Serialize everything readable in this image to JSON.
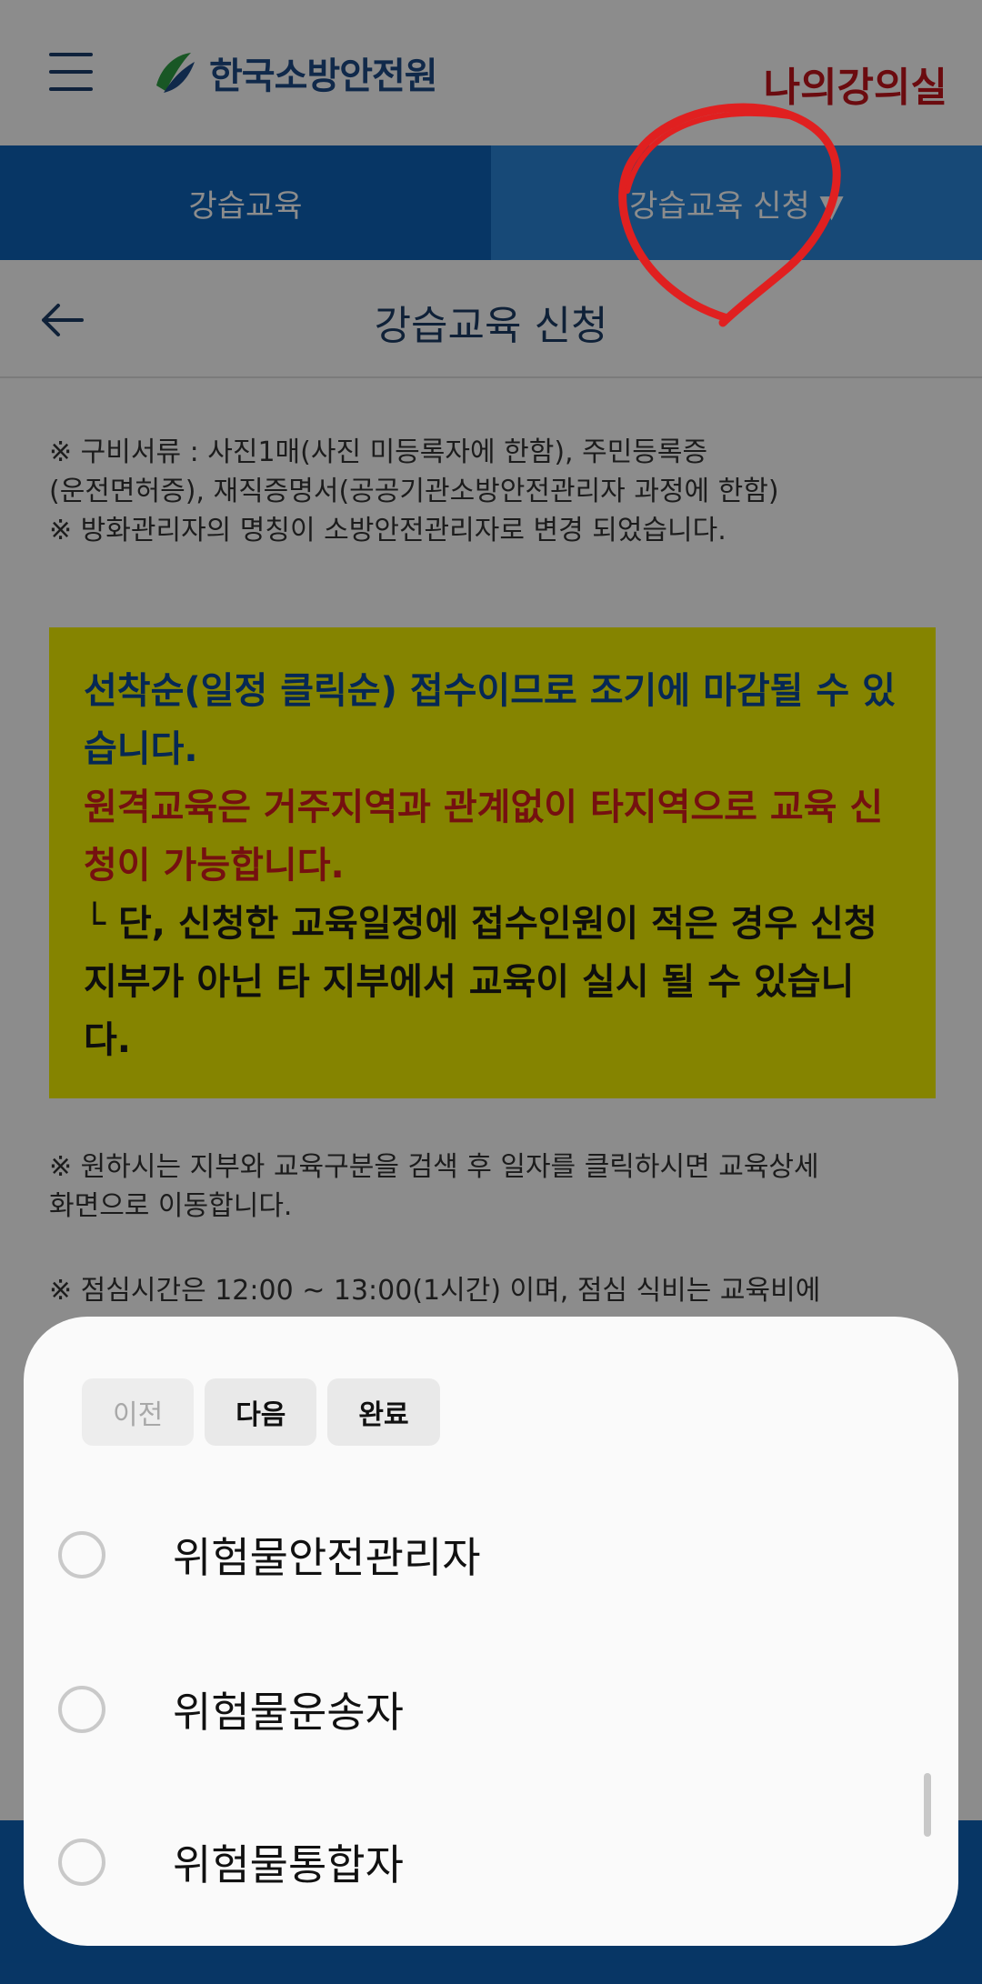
{
  "header": {
    "logo_text": "한국소방안전원",
    "my_class_label": "나의강의실"
  },
  "tabs": [
    {
      "label": "강습교육"
    },
    {
      "label": "강습교육 신청 ▼"
    }
  ],
  "page": {
    "title": "강습교육 신청"
  },
  "notices": {
    "docs_line1": "※ 구비서류 : 사진1매(사진 미등록자에 한함), 주민등록증",
    "docs_line2": "(운전면허증), 재직증명서(공공기관소방안전관리자 과정에 한함)",
    "rename_line": "※ 방화관리자의 명칭이 소방안전관리자로 변경 되었습니다.",
    "search_line1": "※ 원하시는 지부와 교육구분을 검색 후 일자를 클릭하시면 교육상세",
    "search_line2": "화면으로 이동합니다.",
    "lunch_line": "※ 점심시간은 12:00 ~ 13:00(1시간) 이며, 점심 식비는 교육비에"
  },
  "highlight_box": {
    "blue_text": "선착순(일정 클릭순) 접수이므로 조기에 마감될 수 있습니다.",
    "red_text": "원격교육은 거주지역과 관계없이 타지역으로 교육 신청이 가능합니다.",
    "black_text": "└ 단, 신청한 교육일정에 접수인원이 적은 경우 신청지부가 아닌 타 지부에서 교육이 실시 될 수 있습니다."
  },
  "picker": {
    "prev_label": "이전",
    "next_label": "다음",
    "done_label": "완료",
    "options": [
      {
        "label": "위험물안전관리자"
      },
      {
        "label": "위험물운송자"
      },
      {
        "label": "위험물통합자"
      }
    ]
  },
  "colors": {
    "primary_blue": "#0e63b8",
    "tab_active": "#2b86d9",
    "highlight_yellow": "#f3f100",
    "annotation_red": "#d42020"
  }
}
